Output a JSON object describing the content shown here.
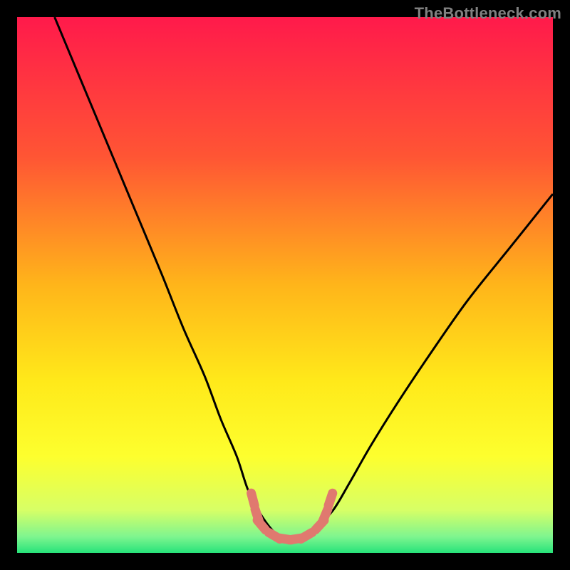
{
  "watermark": "TheBottleneck.com",
  "chart_data": {
    "type": "line",
    "title": "",
    "xlabel": "",
    "ylabel": "",
    "xlim": [
      0,
      100
    ],
    "ylim": [
      0,
      100
    ],
    "grid": false,
    "legend": false,
    "background_gradient": {
      "stops": [
        {
          "pos": 0.0,
          "color": "#ff1a4b"
        },
        {
          "pos": 0.26,
          "color": "#ff5534"
        },
        {
          "pos": 0.5,
          "color": "#ffb51a"
        },
        {
          "pos": 0.68,
          "color": "#ffe91a"
        },
        {
          "pos": 0.82,
          "color": "#fdff2e"
        },
        {
          "pos": 0.92,
          "color": "#d7ff66"
        },
        {
          "pos": 0.97,
          "color": "#7ef58f"
        },
        {
          "pos": 1.0,
          "color": "#27e37a"
        }
      ]
    },
    "series": [
      {
        "name": "bottleneck-curve",
        "color": "#000000",
        "x": [
          7,
          12,
          17,
          22,
          27,
          31,
          35,
          38,
          41,
          43,
          45,
          47,
          49,
          51,
          53,
          56,
          59,
          62,
          66,
          71,
          77,
          84,
          92,
          100
        ],
        "y": [
          100,
          88,
          76,
          64,
          52,
          42,
          33,
          25,
          18,
          12,
          8,
          5,
          3,
          2.5,
          3,
          5,
          8,
          13,
          20,
          28,
          37,
          47,
          57,
          67
        ]
      }
    ],
    "markers": {
      "name": "bottleneck-safe-zone",
      "color": "#e0796f",
      "points": [
        {
          "x": 44.0,
          "y": 10.0
        },
        {
          "x": 44.8,
          "y": 7.0
        },
        {
          "x": 45.6,
          "y": 5.2
        },
        {
          "x": 48.0,
          "y": 3.2
        },
        {
          "x": 50.0,
          "y": 2.6
        },
        {
          "x": 52.0,
          "y": 2.6
        },
        {
          "x": 54.0,
          "y": 3.2
        },
        {
          "x": 56.5,
          "y": 5.2
        },
        {
          "x": 57.5,
          "y": 7.0
        },
        {
          "x": 58.5,
          "y": 10.0
        }
      ]
    }
  }
}
